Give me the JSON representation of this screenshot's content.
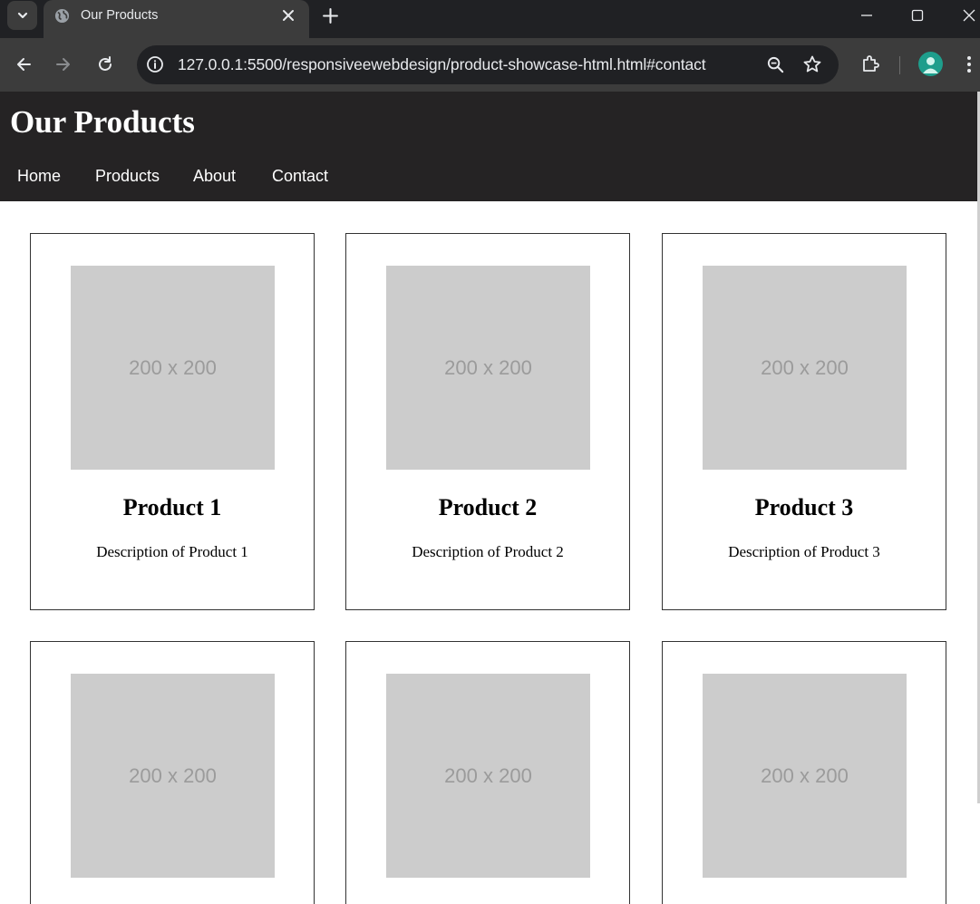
{
  "browser": {
    "tab_title": "Our Products",
    "url": "127.0.0.1:5500/responsiveewebdesign/product-showcase-html.html#contact",
    "icons": {
      "tab_search": "chevron-down-icon",
      "favicon": "globe-icon",
      "tab_close": "close-icon",
      "new_tab": "plus-icon",
      "back": "back-arrow-icon",
      "forward": "forward-arrow-icon",
      "reload": "reload-icon",
      "site_info": "info-icon",
      "zoom": "zoom-out-icon",
      "bookmark": "star-icon",
      "extensions": "puzzle-icon",
      "profile": "avatar-icon",
      "menu": "kebab-menu-icon"
    }
  },
  "site": {
    "title": "Our Products",
    "nav": [
      "Home",
      "Products",
      "About",
      "Contact"
    ],
    "colors": {
      "header_bg": "#252324",
      "placeholder_bg": "#cccccc",
      "placeholder_text": "#9b9b9b"
    }
  },
  "products": [
    {
      "image_text": "200 x 200",
      "title": "Product 1",
      "description": "Description of Product 1"
    },
    {
      "image_text": "200 x 200",
      "title": "Product 2",
      "description": "Description of Product 2"
    },
    {
      "image_text": "200 x 200",
      "title": "Product 3",
      "description": "Description of Product 3"
    },
    {
      "image_text": "200 x 200"
    },
    {
      "image_text": "200 x 200"
    },
    {
      "image_text": "200 x 200"
    }
  ]
}
